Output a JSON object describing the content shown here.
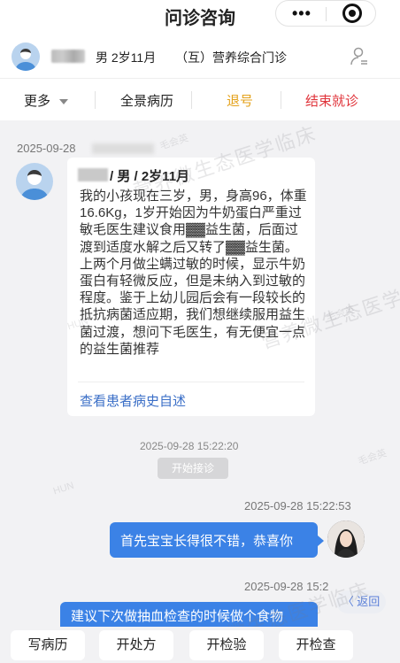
{
  "header": {
    "title": "问诊咨询"
  },
  "patient": {
    "gender_age": "男  2岁11月",
    "clinic": "（互）营养综合门诊"
  },
  "actions": [
    {
      "label": "更多",
      "color": "#222222"
    },
    {
      "label": "全景病历",
      "color": "#222222"
    },
    {
      "label": "退号",
      "color": "#e4a21b"
    },
    {
      "label": "结束就诊",
      "color": "#e0343b"
    }
  ],
  "chat": {
    "first_date": "2025-09-28",
    "card": {
      "header_suffix": "/ 男 / 2岁11月",
      "body": "我的小孩现在三岁，男，身高96，体重16.6Kg，1岁开始因为牛奶蛋白严重过敏毛医生建议食用▓▓益生菌，后面过渡到适度水解之后又转了▓▓益生菌。上两个月做尘螨过敏的时候，显示牛奶蛋白有轻微反应，但是未纳入到过敏的程度。鉴于上幼儿园后会有一段较长的抵抗病菌适应期，我们想继续服用益生菌过渡，想问下毛医生，有无便宜一点的益生菌推荐",
      "link": "查看患者病史自述"
    },
    "system": {
      "time": "2025-09-28 15:22:20",
      "badge": "开始接诊"
    },
    "msg1": {
      "time": "2025-09-28 15:22:53",
      "text": "首先宝宝长得很不错，恭喜你"
    },
    "msg2": {
      "time": "2025-09-28 15:2",
      "text": "建议下次做抽血检查的时候做个食物"
    },
    "back": "〈 返回"
  },
  "watermarks": {
    "brand": "营养微生态医学临床",
    "doctor": "毛会英",
    "code": "HUN"
  },
  "bottom_buttons": [
    "写病历",
    "开处方",
    "开检验",
    "开检查"
  ],
  "colors": {
    "accent": "#3b82e6",
    "link": "#3b6fc7",
    "warning": "#e4a21b",
    "danger": "#e0343b"
  }
}
